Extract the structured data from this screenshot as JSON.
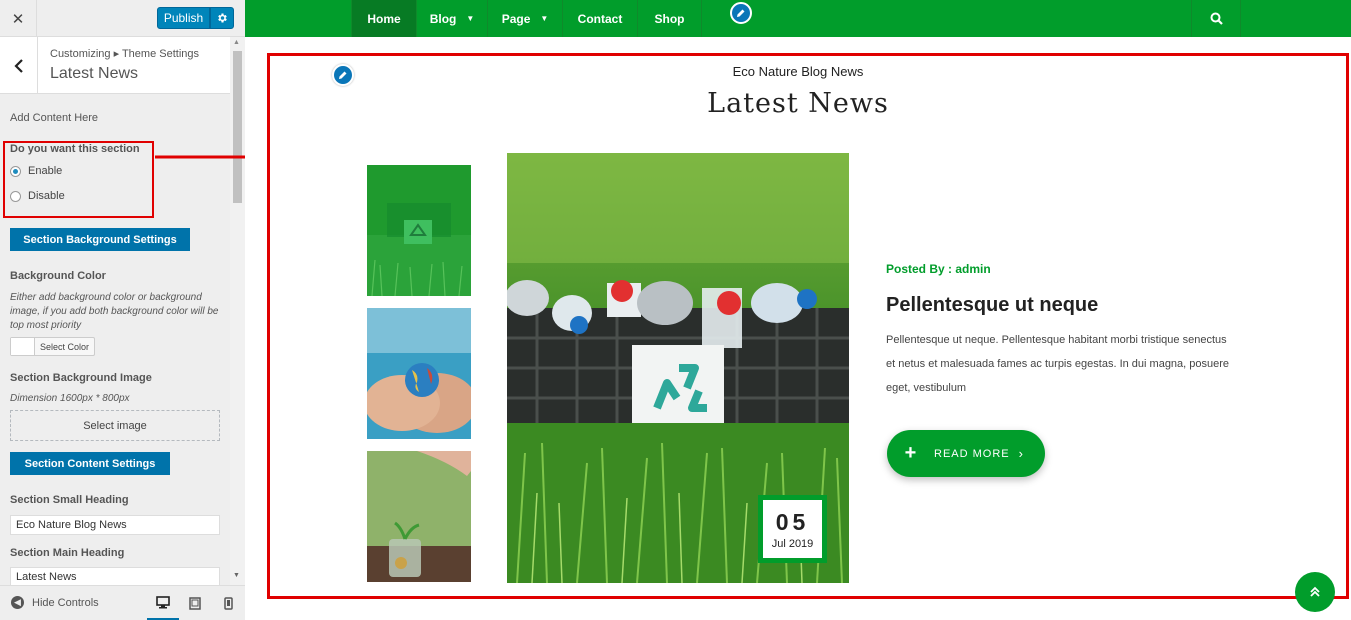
{
  "customizer": {
    "close_label": "✕",
    "publish_label": "Publish",
    "breadcrumb": "Customizing ▸ Theme Settings",
    "section_title": "Latest News",
    "add_content": "Add Content Here",
    "enable_question": "Do you want this section",
    "radio_options": [
      "Enable",
      "Disable"
    ],
    "radio_selected": "Enable",
    "bg_settings_button": "Section Background Settings",
    "bg_color_label": "Background Color",
    "bg_color_help": "Either add background color or background image, if you add both background color will be top most priority",
    "select_color_label": "Select Color",
    "bg_image_label": "Section Background Image",
    "bg_image_dimension": "Dimension 1600px * 800px",
    "select_image_label": "Select image",
    "content_settings_button": "Section Content Settings",
    "small_heading_label": "Section Small Heading",
    "small_heading_value": "Eco Nature Blog News",
    "main_heading_label": "Section Main Heading",
    "main_heading_value": "Latest News",
    "hide_controls": "Hide Controls"
  },
  "nav": {
    "items": [
      {
        "label": "Home",
        "active": true,
        "dropdown": false
      },
      {
        "label": "Blog",
        "active": false,
        "dropdown": true
      },
      {
        "label": "Page",
        "active": false,
        "dropdown": true
      },
      {
        "label": "Contact",
        "active": false,
        "dropdown": false
      },
      {
        "label": "Shop",
        "active": false,
        "dropdown": false
      }
    ]
  },
  "section": {
    "small_heading": "Eco Nature Blog News",
    "main_heading": "Latest News"
  },
  "post": {
    "posted_by": "Posted By : admin",
    "title": "Pellentesque ut neque",
    "excerpt": "Pellentesque ut neque. Pellentesque habitant morbi tristique senectus et netus et malesuada fames ac turpis egestas. In dui magna, posuere eget, vestibulum",
    "read_more": "READ MORE",
    "date_day": "05",
    "date_month_year": "Jul 2019"
  },
  "colors": {
    "brand_green": "#019d2b",
    "wp_blue": "#0073aa",
    "highlight_red": "#e00000"
  }
}
